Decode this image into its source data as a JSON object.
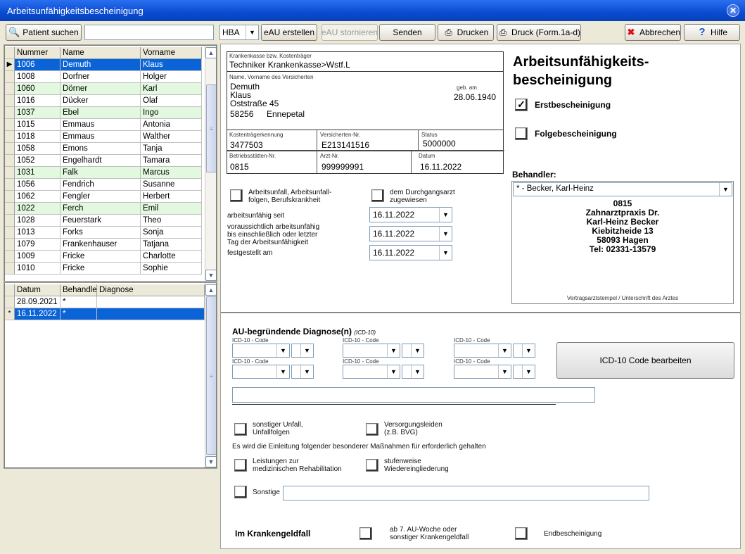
{
  "window": {
    "title": "Arbeitsunfähigkeitsbescheinigung",
    "close": "✕"
  },
  "toolbar": {
    "patient_search": "Patient suchen",
    "search_value": "",
    "hba": "HBA",
    "eau_create": "eAU erstellen",
    "eau_cancel": "eAU stornieren",
    "send": "Senden",
    "print": "Drucken",
    "print_form": "Druck (Form.1a-d)",
    "cancel": "Abbrechen",
    "help": "Hilfe"
  },
  "patients": {
    "headers": [
      "Nummer",
      "Name",
      "Vorname"
    ],
    "rows": [
      {
        "nr": "1006",
        "name": "Demuth",
        "vorname": "Klaus",
        "state": "selected"
      },
      {
        "nr": "1008",
        "name": "Dorfner",
        "vorname": "Holger",
        "state": ""
      },
      {
        "nr": "1060",
        "name": "Dörner",
        "vorname": "Karl",
        "state": "green"
      },
      {
        "nr": "1016",
        "name": "Dücker",
        "vorname": "Olaf",
        "state": ""
      },
      {
        "nr": "1037",
        "name": "Ebel",
        "vorname": "Ingo",
        "state": "green"
      },
      {
        "nr": "1015",
        "name": "Emmaus",
        "vorname": "Antonia",
        "state": ""
      },
      {
        "nr": "1018",
        "name": "Emmaus",
        "vorname": "Walther",
        "state": ""
      },
      {
        "nr": "1058",
        "name": "Emons",
        "vorname": "Tanja",
        "state": ""
      },
      {
        "nr": "1052",
        "name": "Engelhardt",
        "vorname": "Tamara",
        "state": ""
      },
      {
        "nr": "1031",
        "name": "Falk",
        "vorname": "Marcus",
        "state": "green"
      },
      {
        "nr": "1056",
        "name": "Fendrich",
        "vorname": "Susanne",
        "state": ""
      },
      {
        "nr": "1062",
        "name": "Fengler",
        "vorname": "Herbert",
        "state": ""
      },
      {
        "nr": "1022",
        "name": "Ferch",
        "vorname": "Emil",
        "state": "green"
      },
      {
        "nr": "1028",
        "name": "Feuerstark",
        "vorname": "Theo",
        "state": ""
      },
      {
        "nr": "1013",
        "name": "Forks",
        "vorname": "Sonja",
        "state": ""
      },
      {
        "nr": "1079",
        "name": "Frankenhauser",
        "vorname": "Tatjana",
        "state": ""
      },
      {
        "nr": "1009",
        "name": "Fricke",
        "vorname": "Charlotte",
        "state": ""
      },
      {
        "nr": "1010",
        "name": "Fricke",
        "vorname": "Sophie",
        "state": ""
      }
    ]
  },
  "history": {
    "headers": [
      "Datum",
      "Behandler",
      "Diagnose"
    ],
    "rows": [
      {
        "ind": "",
        "datum": "28.09.2021",
        "behandler": "*",
        "diagnose": "",
        "state": ""
      },
      {
        "ind": "*",
        "datum": "16.11.2022",
        "behandler": "*",
        "diagnose": "",
        "state": "selected"
      }
    ]
  },
  "insurance": {
    "kasse_label": "Krankenkasse bzw. Kostenträger",
    "kasse": "Techniker Krankenkasse>Wstf.L",
    "name_label": "Name, Vorname des Versicherten",
    "nachname": "Demuth",
    "vorname": "Klaus",
    "strasse": "Oststraße 45",
    "plz": "58256",
    "ort": "Ennepetal",
    "geb_label": "geb. am",
    "geb": "28.06.1940",
    "ktk_label": "Kostenträgerkennung",
    "ktk": "3477503",
    "vnr_label": "Versicherten-Nr.",
    "vnr": "E213141516",
    "status_label": "Status",
    "status": "5000000",
    "bsnr_label": "Betriebsstätten-Nr.",
    "bsnr": "0815",
    "arzt_label": "Arzt-Nr.",
    "arzt": "999999991",
    "datum_label": "Datum",
    "datum": "16.11.2022"
  },
  "heading": {
    "line1": "Arbeitsunfähigkeits-",
    "line2": "bescheinigung"
  },
  "types": {
    "erst": "Erstbescheinigung",
    "erst_check": "✓",
    "folge": "Folgebescheinigung"
  },
  "behandler": {
    "label": "Behandler:",
    "selected": "* - Becker, Karl-Heinz",
    "stamp": [
      "0815",
      "Zahnarztpraxis Dr.",
      "Karl-Heinz  Becker",
      "Kiebitzheide  13",
      "58093 Hagen",
      "Tel: 02331-13579"
    ],
    "footer": "Vertragsarztstempel / Unterschrift des Arztes"
  },
  "accident": {
    "label1": "Arbeitsunfall, Arbeitsunfall-",
    "label2": "folgen, Berufskrankheit",
    "durchgang1": "dem Durchgangsarzt",
    "durchgang2": "zugewiesen"
  },
  "dates": {
    "seit_label": "arbeitsunfähig seit",
    "seit": "16.11.2022",
    "bis_label1": "voraussichtlich arbeitsunfähig",
    "bis_label2": "bis einschließlich oder letzter",
    "bis_label3": "Tag der Arbeitsunfähigkeit",
    "bis": "16.11.2022",
    "fest_label": "festgestellt am",
    "fest": "16.11.2022"
  },
  "diagnosis": {
    "title": "AU-begründende Diagnose(n)",
    "sub": "(ICD-10)",
    "code_label": "ICD-10 - Code",
    "edit_button": "ICD-10 Code bearbeiten",
    "text": ""
  },
  "extra": {
    "unfall1": "sonstiger Unfall,",
    "unfall2": "Unfallfolgen",
    "vers1": "Versorgungsleiden",
    "vers2": "(z.B. BVG)",
    "massnahmen": "Es wird die Einleitung folgender besonderer Maßnahmen für erforderlich gehalten",
    "reha1": "Leistungen zur",
    "reha2": "medizinischen Rehabilitation",
    "stufen1": "stufenweise",
    "stufen2": "Wiedereingliederung",
    "sonstige": "Sonstige",
    "sonstige_text": ""
  },
  "krankengeld": {
    "title": "Im Krankengeldfall",
    "ab1": "ab 7. AU-Woche oder",
    "ab2": "sonstiger Krankengeldfall",
    "end": "Endbescheinigung"
  },
  "colors": {
    "titlebar": "#0a4bd2",
    "selected": "#0a64d8",
    "green": "#e2f9df",
    "cancel_x": "#d11"
  }
}
